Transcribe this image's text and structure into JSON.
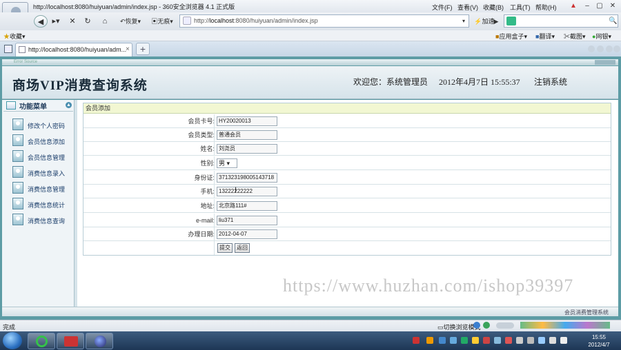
{
  "browser": {
    "window_title": "http://localhost:8080/huiyuan/admin/index.jsp - 360安全浏览器 4.1 正式版",
    "menus": [
      "文件(F)",
      "查看(V)",
      "收藏(B)",
      "工具(T)",
      "帮助(H)"
    ],
    "nav": {
      "restore_label": "恢复",
      "noimage_label": "无痕",
      "accel_label": "加速"
    },
    "address": {
      "prefix": "http://",
      "host": "localhost",
      "rest": ":8080/huiyuan/admin/index.jsp"
    },
    "bookmarks": {
      "favorites": "收藏",
      "right": [
        "应用盒子",
        "翻译",
        "截图",
        "网银"
      ]
    },
    "tab_title": "http://localhost:8080/huiyuan/adm...",
    "status_left": "完成",
    "status_right": "切换浏览模式"
  },
  "app": {
    "strip_label": "Error Source",
    "title": "商场VIP消费查询系统",
    "welcome": "欢迎您：系统管理员",
    "datetime": "2012年4月7日  15:55:37",
    "logout": "注销系统",
    "footer": "会员消费管理系统"
  },
  "sidebar": {
    "title": "功能菜单",
    "items": [
      {
        "label": "修改个人密码"
      },
      {
        "label": "会员信息添加"
      },
      {
        "label": "会员信息管理"
      },
      {
        "label": "消费信息录入"
      },
      {
        "label": "消费信息管理"
      },
      {
        "label": "消费信息统计"
      },
      {
        "label": "消费信息查询"
      }
    ]
  },
  "form": {
    "title": "会员添加",
    "fields": {
      "card_no": {
        "label": "会员卡号:",
        "value": "HY20020013"
      },
      "member_type": {
        "label": "会员类型:",
        "value": "普通会员"
      },
      "name": {
        "label": "姓名:",
        "value": "刘尧员"
      },
      "gender": {
        "label": "性别:",
        "value": "男"
      },
      "id_card": {
        "label": "身份证:",
        "value": "371323198005143718"
      },
      "phone": {
        "label": "手机:",
        "value": "13222222222"
      },
      "address": {
        "label": "地址:",
        "value": "北京路111#"
      },
      "email": {
        "label": "e-mail:",
        "value": "liu371"
      },
      "join_date": {
        "label": "办理日期:",
        "value": "2012-04-07"
      }
    },
    "submit": "提交",
    "back": "返回"
  },
  "watermark": "https://www.huzhan.com/ishop39397",
  "taskbar": {
    "time": "15:55",
    "date": "2012/4/7"
  }
}
